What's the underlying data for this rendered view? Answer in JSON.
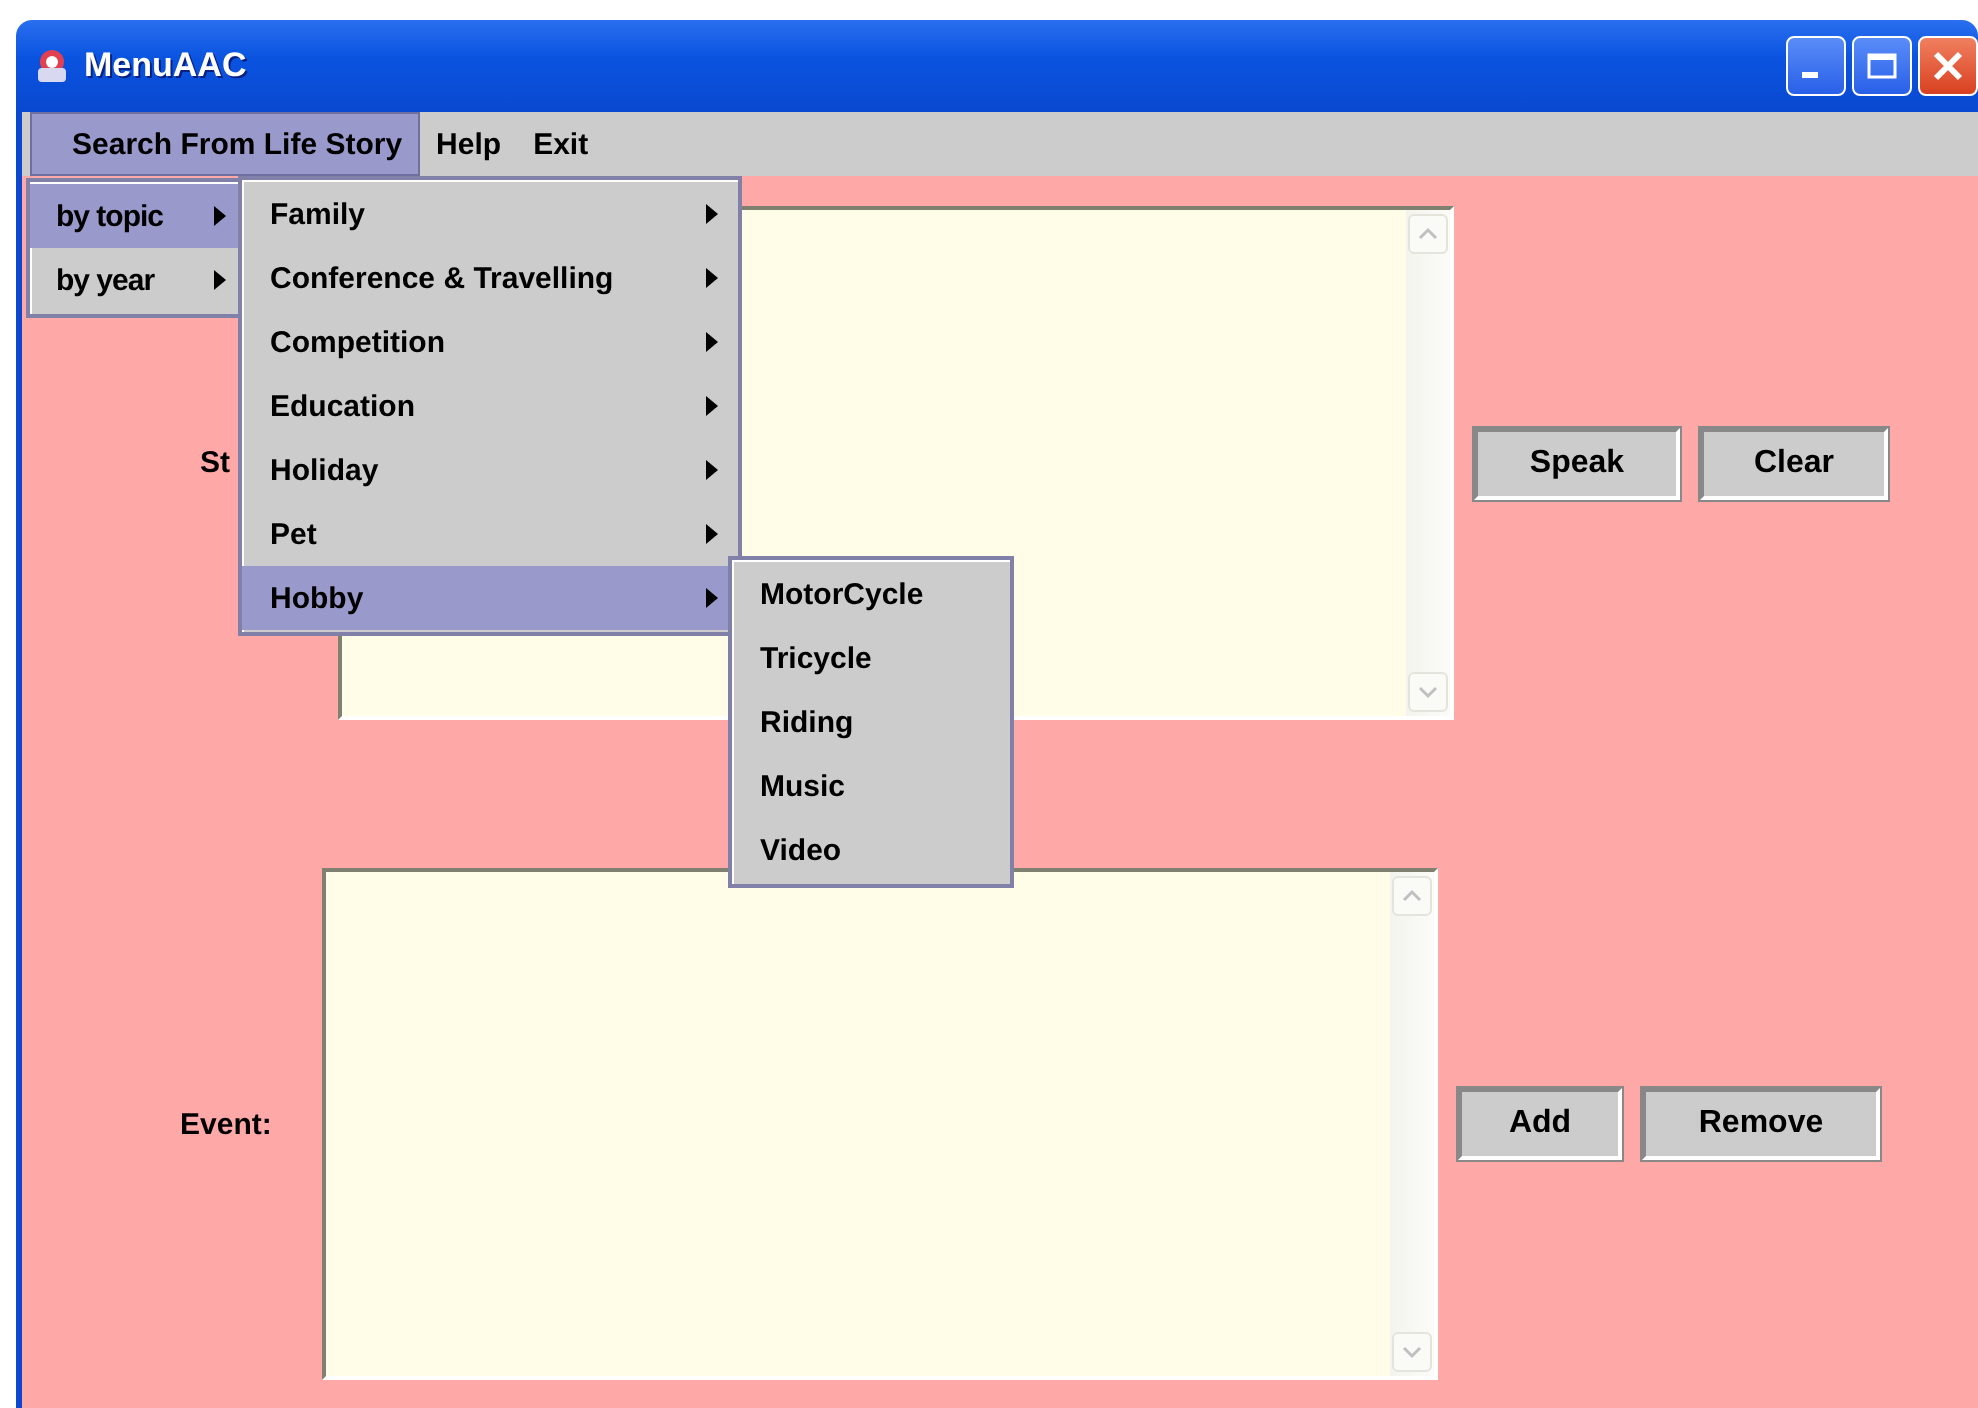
{
  "window": {
    "title": "MenuAAC"
  },
  "menu_bar": [
    {
      "label": "Search From Life Story",
      "selected": true
    },
    {
      "label": "Help",
      "selected": false
    },
    {
      "label": "Exit",
      "selected": false
    }
  ],
  "open_menus": [
    {
      "items": [
        {
          "label": "by topic",
          "selected": true,
          "has_submenu": true
        },
        {
          "label": "by year",
          "selected": false,
          "has_submenu": true
        }
      ]
    },
    {
      "items": [
        {
          "label": "Family",
          "selected": false,
          "has_submenu": true
        },
        {
          "label": "Conference & Travelling",
          "selected": false,
          "has_submenu": true
        },
        {
          "label": "Competition",
          "selected": false,
          "has_submenu": true
        },
        {
          "label": "Education",
          "selected": false,
          "has_submenu": true
        },
        {
          "label": "Holiday",
          "selected": false,
          "has_submenu": true
        },
        {
          "label": "Pet",
          "selected": false,
          "has_submenu": true
        },
        {
          "label": "Hobby",
          "selected": true,
          "has_submenu": true
        }
      ]
    },
    {
      "items": [
        {
          "label": "MotorCycle",
          "selected": false,
          "has_submenu": false
        },
        {
          "label": "Tricycle",
          "selected": false,
          "has_submenu": false
        },
        {
          "label": "Riding",
          "selected": false,
          "has_submenu": false
        },
        {
          "label": "Music",
          "selected": false,
          "has_submenu": false
        },
        {
          "label": "Video",
          "selected": false,
          "has_submenu": false
        }
      ]
    }
  ],
  "story": {
    "label": "St",
    "buttons": [
      "Speak",
      "Clear"
    ]
  },
  "event": {
    "label": "Event:",
    "buttons": [
      "Add",
      "Remove"
    ]
  }
}
